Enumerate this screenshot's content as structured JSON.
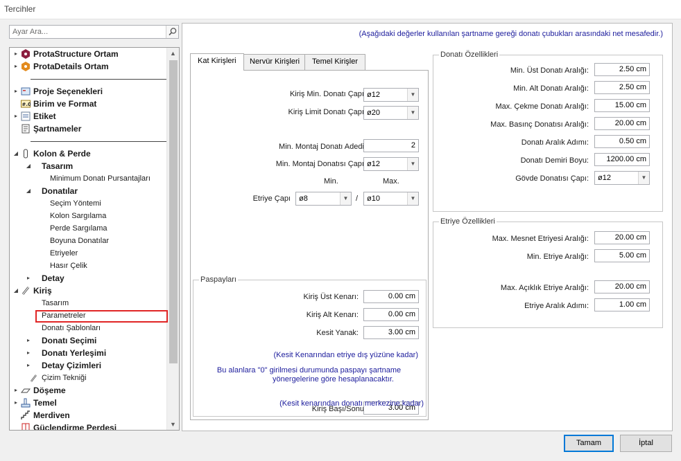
{
  "window": {
    "title": "Tercihler"
  },
  "search": {
    "placeholder": "Ayar Ara..."
  },
  "tree": {
    "items": [
      {
        "label": "ProtaStructure Ortam",
        "level": 0,
        "bold": true,
        "toggle": "▸"
      },
      {
        "label": "ProtaDetails Ortam",
        "level": 0,
        "bold": true,
        "toggle": "▸"
      },
      {
        "label": "Proje Seçenekleri",
        "level": 0,
        "bold": true,
        "toggle": "▸"
      },
      {
        "label": "Birim ve Format",
        "level": 0,
        "bold": true,
        "toggle": ""
      },
      {
        "label": "Etiket",
        "level": 0,
        "bold": true,
        "toggle": "▸"
      },
      {
        "label": "Şartnameler",
        "level": 0,
        "bold": true,
        "toggle": ""
      },
      {
        "label": "Kolon & Perde",
        "level": 0,
        "bold": true,
        "toggle": "◢"
      },
      {
        "label": "Tasarım",
        "level": 1,
        "bold": true,
        "toggle": "◢"
      },
      {
        "label": "Minimum Donatı Pursantajları",
        "level": 2,
        "bold": false
      },
      {
        "label": "Donatılar",
        "level": 1,
        "bold": true,
        "toggle": "◢"
      },
      {
        "label": "Seçim Yöntemi",
        "level": 2,
        "bold": false
      },
      {
        "label": "Kolon Sargılama",
        "level": 2,
        "bold": false
      },
      {
        "label": "Perde Sargılama",
        "level": 2,
        "bold": false
      },
      {
        "label": "Boyuna Donatılar",
        "level": 2,
        "bold": false
      },
      {
        "label": "Etriyeler",
        "level": 2,
        "bold": false
      },
      {
        "label": "Hasır Çelik",
        "level": 2,
        "bold": false
      },
      {
        "label": "Detay",
        "level": 1,
        "bold": true,
        "toggle": "▸"
      },
      {
        "label": "Kiriş",
        "level": 0,
        "bold": true,
        "toggle": "◢"
      },
      {
        "label": "Tasarım",
        "level": 1,
        "bold": false
      },
      {
        "label": "Parametreler",
        "level": 1,
        "bold": false
      },
      {
        "label": "Donatı Şablonları",
        "level": 1,
        "bold": false
      },
      {
        "label": "Donatı Seçimi",
        "level": 1,
        "bold": true,
        "toggle": "▸"
      },
      {
        "label": "Donatı Yerleşimi",
        "level": 1,
        "bold": true,
        "toggle": "▸"
      },
      {
        "label": "Detay Çizimleri",
        "level": 1,
        "bold": true,
        "toggle": "▸"
      },
      {
        "label": "Çizim Tekniği",
        "level": 1,
        "bold": false
      },
      {
        "label": "Döşeme",
        "level": 0,
        "bold": true,
        "toggle": "▸"
      },
      {
        "label": "Temel",
        "level": 0,
        "bold": true,
        "toggle": "▸"
      },
      {
        "label": "Merdiven",
        "level": 0,
        "bold": true,
        "toggle": ""
      },
      {
        "label": "Güçlendirme Perdesi",
        "level": 0,
        "bold": true,
        "toggle": ""
      }
    ]
  },
  "note": "(Aşağıdaki değerler kullanılan şartname gereği donatı çubukları arasındaki net mesafedir.)",
  "tabs": [
    "Kat Kirişleri",
    "Nervür Kirişleri",
    "Temel Kirişler"
  ],
  "kat": {
    "min_bar_label": "Kiriş Min. Donatı Çapı:",
    "min_bar": "ø12",
    "limit_bar_label": "Kiriş Limit Donatı Çapı:",
    "limit_bar": "ø20",
    "min_montaj_count_label": "Min. Montaj Donatı Adedi:",
    "min_montaj_count": "2",
    "min_montaj_bar_label": "Min. Montaj Donatısı Çapı:",
    "min_montaj_bar": "ø12",
    "min_header": "Min.",
    "max_header": "Max.",
    "etriye_label": "Etriye Çapı",
    "etriye_min": "ø8",
    "slash": "/",
    "etriye_max": "ø10"
  },
  "paspay": {
    "title": "Paspayları",
    "ust_label": "Kiriş Üst Kenarı:",
    "ust": "0.00 cm",
    "alt_label": "Kiriş Alt Kenarı:",
    "alt": "0.00 cm",
    "yanak_label": "Kesit Yanak:",
    "yanak": "3.00 cm",
    "note1": "(Kesit Kenarından etriye dış yüzüne kadar)",
    "note2a": "Bu alanlara \"0\" girilmesi durumunda paspayı şartname",
    "note2b": "yönergelerine göre hesaplanacaktır.",
    "basi_label": "Kiriş Başı/Sonu:",
    "basi": "3.00 cm",
    "note3": "(Kesit kenarından donatı merkezine kadar)"
  },
  "donati": {
    "title": "Donatı Özellikleri",
    "rows": [
      {
        "label": "Min. Üst Donatı Aralığı:",
        "value": "2.50 cm"
      },
      {
        "label": "Min. Alt Donatı Aralığı:",
        "value": "2.50 cm"
      },
      {
        "label": "Max. Çekme Donatı Aralığı:",
        "value": "15.00 cm"
      },
      {
        "label": "Max. Basınç Donatısı Aralığı:",
        "value": "20.00 cm"
      },
      {
        "label": "Donatı Aralık Adımı:",
        "value": "0.50 cm"
      },
      {
        "label": "Donatı Demiri Boyu:",
        "value": "1200.00 cm"
      }
    ],
    "govde_label": "Gövde Donatısı Çapı:",
    "govde": "ø12"
  },
  "etriye": {
    "title": "Etriye Özellikleri",
    "mesnet_label": "Max. Mesnet Etriyesi Aralığı:",
    "mesnet": "20.00 cm",
    "min_label": "Min. Etriye Aralığı:",
    "min": "5.00 cm",
    "aciklik_label": "Max. Açıklık Etriye Aralığı:",
    "aciklik": "20.00 cm",
    "adim_label": "Etriye Aralık Adımı:",
    "adim": "1.00 cm"
  },
  "buttons": {
    "ok": "Tamam",
    "cancel": "İptal"
  }
}
